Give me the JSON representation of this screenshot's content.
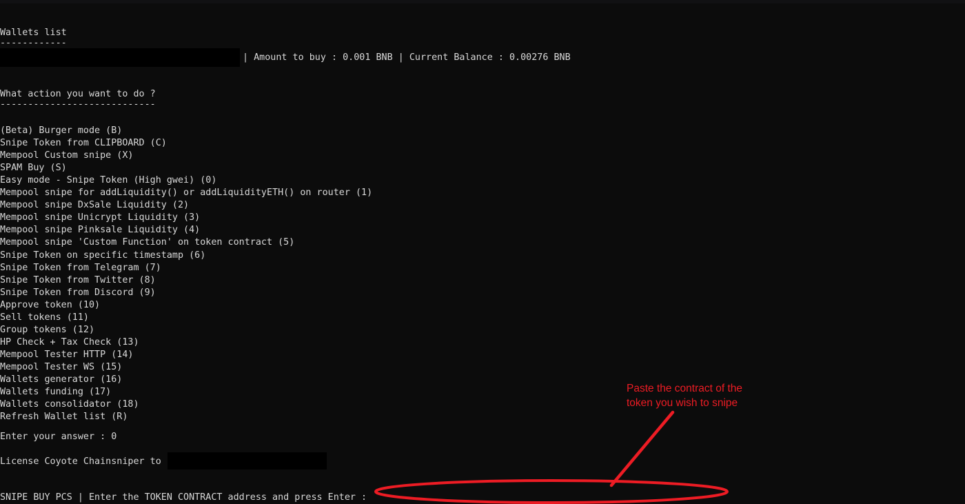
{
  "terminal": {
    "background_color": "#0c0c0c",
    "text_color": "#d9d9d9",
    "wallets_header": "Wallets list",
    "wallets_header_rule": "------------",
    "status_line": "| Amount to buy : 0.001 BNB | Current Balance : 0.00276 BNB",
    "status_amount_label": "Amount to buy",
    "status_amount_value": "0.001 BNB",
    "status_balance_label": "Current Balance",
    "status_balance_value": "0.00276 BNB",
    "prompt_question": "What action you want to do ?",
    "prompt_question_rule": "----------------------------",
    "menu": [
      "(Beta) Burger mode (B)",
      "Snipe Token from CLIPBOARD (C)",
      "Mempool Custom snipe (X)",
      "SPAM Buy (S)",
      "Easy mode - Snipe Token (High gwei) (0)",
      "Mempool snipe for addLiquidity() or addLiquidityETH() on router (1)",
      "Mempool snipe DxSale Liquidity (2)",
      "Mempool snipe Unicrypt Liquidity (3)",
      "Mempool snipe Pinksale Liquidity (4)",
      "Mempool snipe 'Custom Function' on token contract (5)",
      "Snipe Token on specific timestamp (6)",
      "Snipe Token from Telegram (7)",
      "Snipe Token from Twitter (8)",
      "Snipe Token from Discord (9)",
      "Approve token (10)",
      "Sell tokens (11)",
      "Group tokens (12)",
      "HP Check + Tax Check (13)",
      "Mempool Tester HTTP (14)",
      "Mempool Tester WS (15)",
      "Wallets generator (16)",
      "Wallets funding (17)",
      "Wallets consolidator (18)",
      "Refresh Wallet list (R)"
    ],
    "answer_line": "Enter your answer : 0",
    "answer_value": "0",
    "license_line": "License Coyote Chainsniper to",
    "input_prompt": "SNIPE BUY PCS | Enter the TOKEN CONTRACT address and press Enter :",
    "input_value": ""
  },
  "annotation": {
    "color": "#ed1c24",
    "note_line1": "Paste the contract of the",
    "note_line2": "token you wish to snipe",
    "arrow_name": "pointer-arrow",
    "highlight_name": "input-highlight-ellipse"
  }
}
